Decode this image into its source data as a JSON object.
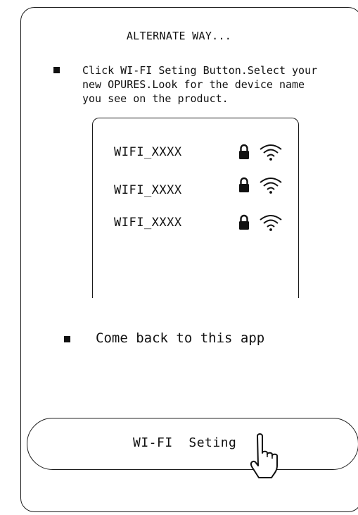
{
  "header": {
    "title": "ALTERNATE WAY..."
  },
  "steps": [
    {
      "icon": "square-bullet-icon",
      "text": "Click WI-FI Seting Button.Select your\nnew OPURES.Look for the device name\nyou see on the product."
    },
    {
      "icon": "square-bullet-icon",
      "text": "Come back to this app"
    }
  ],
  "wifi_list": {
    "networks": [
      {
        "name": "WIFI_XXXX",
        "icons": [
          "lock-icon",
          "wifi-signal-icon"
        ]
      },
      {
        "name": "WIFI_XXXX",
        "icons": [
          "lock-icon",
          "wifi-signal-icon"
        ]
      },
      {
        "name": "WIFI_XXXX",
        "icons": [
          "lock-icon",
          "wifi-signal-icon"
        ]
      }
    ]
  },
  "button": {
    "label": "WI-FI  Seting",
    "icon": "pointing-hand-icon"
  },
  "colors": {
    "stroke": "#1a1a1a",
    "text": "#111111",
    "background": "#ffffff"
  }
}
